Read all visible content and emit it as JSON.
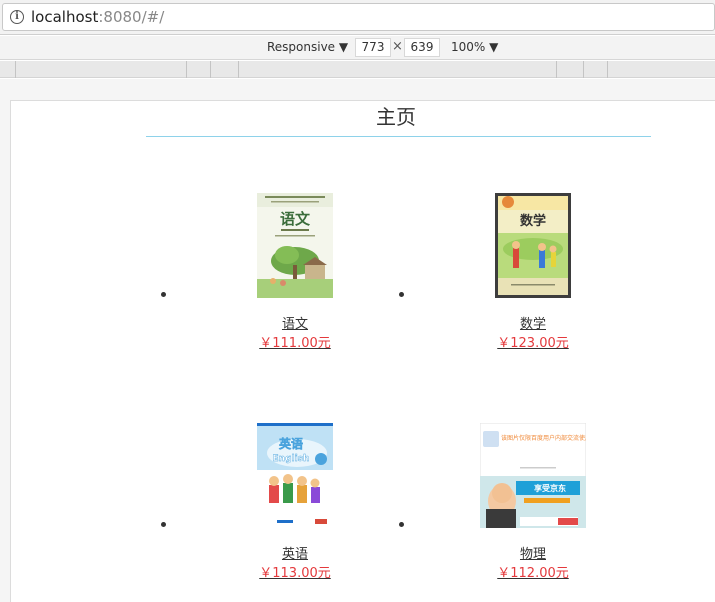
{
  "browser": {
    "url_host": "localhost",
    "url_rest": ":8080/#/"
  },
  "devtools": {
    "device": "Responsive ▼",
    "width": "773",
    "times": "×",
    "height": "639",
    "zoom": "100% ▼"
  },
  "page": {
    "title": "主页"
  },
  "products": [
    {
      "name": "语文",
      "price": "￥111.00元",
      "cover_title": "语文"
    },
    {
      "name": "数学",
      "price": "￥123.00元",
      "cover_title": "数学"
    },
    {
      "name": "英语",
      "price": "￥113.00元",
      "cover_title": "英语",
      "cover_subtitle": "English"
    },
    {
      "name": "物理",
      "price": "￥112.00元",
      "cover_title": "",
      "cover_text_top": "该图片仅限百度用户内部交流使用",
      "cover_badge": "享受京东"
    }
  ],
  "colors": {
    "price": "#e4393c",
    "divider": "#8ed2ea"
  }
}
